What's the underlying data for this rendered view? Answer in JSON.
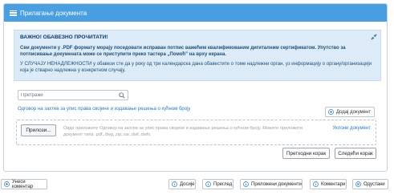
{
  "header": {
    "title": "Прилагање документа",
    "icon": "menu-icon"
  },
  "alert": {
    "heading": "ВАЖНО! ОБАВЕЗНО ПРОЧИТАТИ!",
    "paragraph1": "Сви документи у .PDF формату морају поседовати исправан потпис важећим квалификованим дигиталним сертификатом. Упутство за потписивање докумената може се приступити преко тастера „Помоћ” на врху екрана.",
    "paragraph2": "У СЛУЧАЈУ НЕНАДЛЕЖНОСТИ у обавези сте да у року од три календарска дана обавестите о томе надлежни орган, уз информацију о органу/организацији која је стварно надлежна у конкретном случају."
  },
  "search": {
    "placeholder": "Претражи",
    "icon": "search-icon"
  },
  "document": {
    "title": "Одговор на захтев за упис права својине и издавање решења о кућном броју",
    "add_label": "Додај документ",
    "attach_label": "Прилози...",
    "drop_hint": "Овде приложите Одговор на захтев за упис права својине и издавање решења о кућном броју. Можете приложити документ типа .pdf,.dwg,.zip,.rar,.dwf,.dwfx.",
    "remove_label": "Уклони документ"
  },
  "nav": {
    "prev_label": "Претходни корак",
    "next_label": "Следећи корак"
  },
  "bottom": {
    "comment": "Унеси коментар",
    "dossier": "Досије",
    "overview": "Преглед",
    "attached": "Приложени документи",
    "comments": "Коментари",
    "reject": "Одустани"
  },
  "colors": {
    "header": "#4a9fe0",
    "alert_bg": "#dcebf7",
    "link": "#2a7bc0"
  }
}
